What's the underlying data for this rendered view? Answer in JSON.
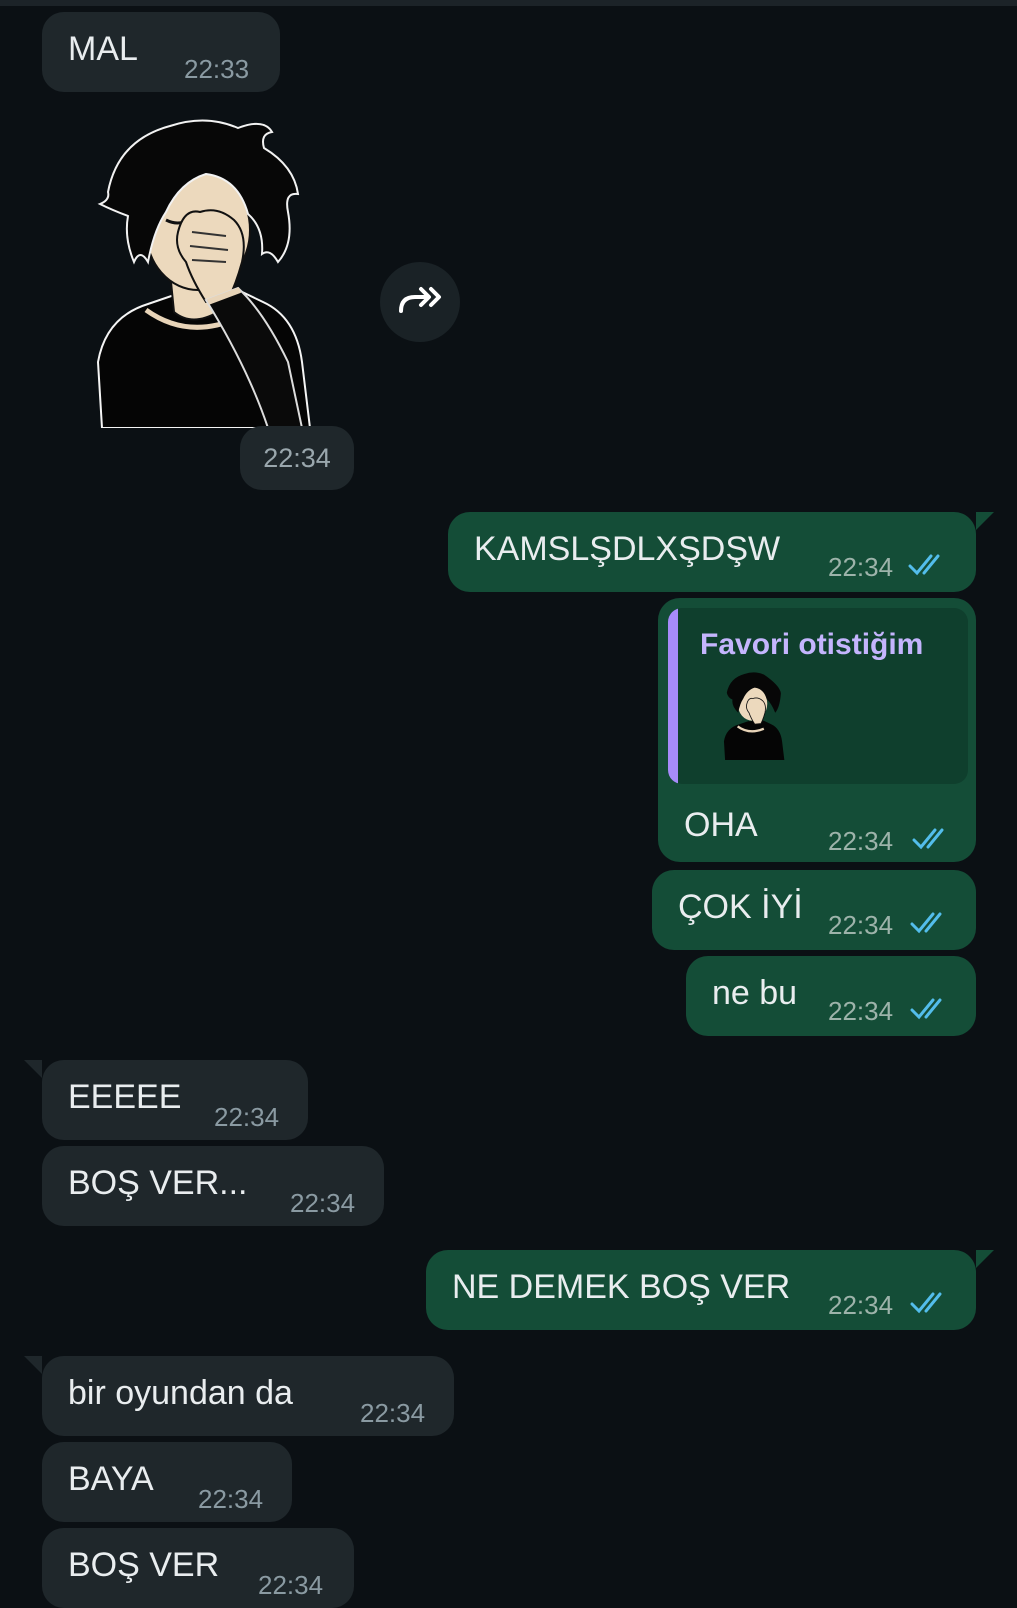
{
  "colors": {
    "background": "#0b1014",
    "incoming_bubble": "#1f272b",
    "outgoing_bubble": "#144d37",
    "quote_bar": "#a78bfa",
    "read_ticks": "#53bdeb"
  },
  "messages": [
    {
      "text": "MAL",
      "time": "22:33"
    },
    {
      "sticker": "facepalm-boy-sticker",
      "time": "22:34"
    },
    {
      "text": "KAMSLŞDLXŞDŞW",
      "time": "22:34",
      "status": "read"
    },
    {
      "reply_to": {
        "sender": "Favori otistiğim",
        "content": "facepalm-boy-sticker"
      },
      "text": "OHA",
      "time": "22:34",
      "status": "read"
    },
    {
      "text": "ÇOK İYİ",
      "time": "22:34",
      "status": "read"
    },
    {
      "text": "ne bu",
      "time": "22:34",
      "status": "read"
    },
    {
      "text": "EEEEE",
      "time": "22:34"
    },
    {
      "text": "BOŞ VER...",
      "time": "22:34"
    },
    {
      "text": "NE DEMEK BOŞ VER",
      "time": "22:34",
      "status": "read"
    },
    {
      "text": "bir oyundan da",
      "time": "22:34"
    },
    {
      "text": "BAYA",
      "time": "22:34"
    },
    {
      "text": "BOŞ VER",
      "time": "22:34"
    }
  ],
  "icons": {
    "forward": "forward-icon",
    "read_receipt": "double-check-icon"
  }
}
